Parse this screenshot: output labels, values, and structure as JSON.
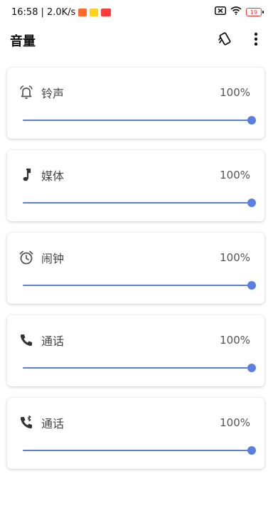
{
  "status_bar": {
    "time": "16:58",
    "speed": "| 2.0K/s",
    "battery": "19"
  },
  "app_bar": {
    "title": "音量"
  },
  "volumes": [
    {
      "label": "铃声",
      "value": "100%",
      "level": 1.0,
      "icon": "bell-icon"
    },
    {
      "label": "媒体",
      "value": "100%",
      "level": 1.0,
      "icon": "music-note-icon"
    },
    {
      "label": "闹钟",
      "value": "100%",
      "level": 1.0,
      "icon": "alarm-clock-icon"
    },
    {
      "label": "通话",
      "value": "100%",
      "level": 1.0,
      "icon": "phone-icon"
    },
    {
      "label": "通话",
      "value": "100%",
      "level": 1.0,
      "icon": "bluetooth-phone-icon"
    }
  ],
  "colors": {
    "accent": "#5b7fe0",
    "track": "#c8d3f5"
  }
}
